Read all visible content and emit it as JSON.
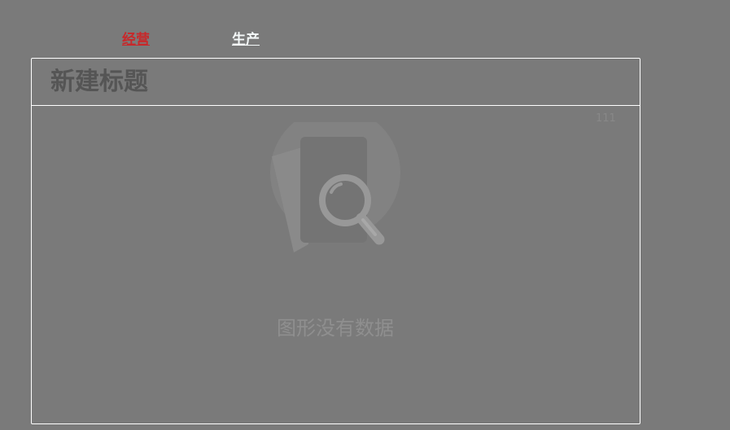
{
  "tabs": [
    {
      "label": "经营",
      "color": "#c8282a",
      "active": true
    },
    {
      "label": "生产",
      "color": "#f4f8f8",
      "active": false
    }
  ],
  "panel": {
    "title": "新建标题",
    "corner_label": "111",
    "empty_state": {
      "icon": "no-data-magnifier-icon",
      "message": "图形没有数据"
    }
  }
}
